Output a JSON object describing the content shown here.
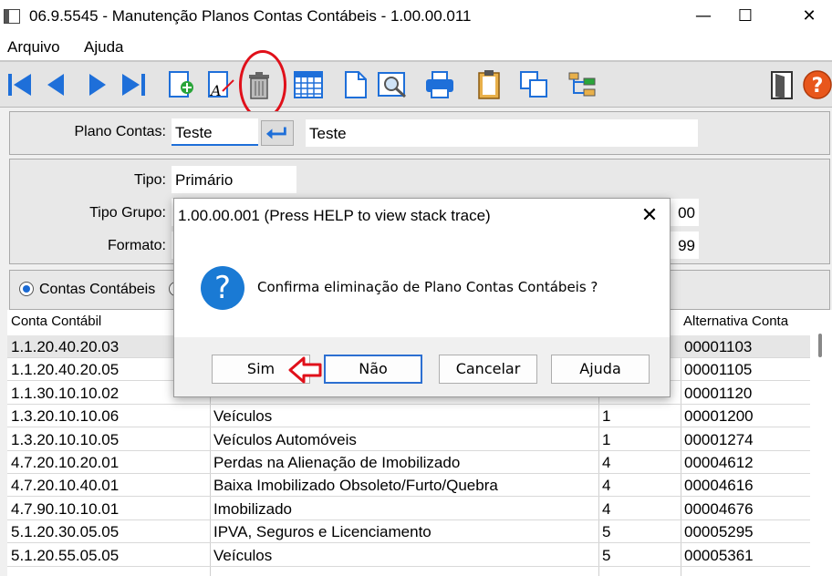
{
  "window": {
    "title": "06.9.5545 - Manutenção Planos Contas Contábeis - 1.00.00.011",
    "minimize": "—",
    "maximize": "☐",
    "close": "✕"
  },
  "menu": [
    "Arquivo",
    "Ajuda"
  ],
  "toolbar": {
    "buttons": [
      "first-icon",
      "previous-icon",
      "next-icon",
      "last-icon",
      "new-record-icon",
      "edit-icon",
      "delete-icon",
      "grid-icon",
      "document-icon",
      "preview-icon",
      "print-icon",
      "clipboard-icon",
      "copy-icon",
      "tree-icon",
      "exit-door-icon",
      "help-icon"
    ],
    "help": "?"
  },
  "form": {
    "plano_contas_label": "Plano Contas:",
    "plano_contas_value": "Teste",
    "plano_contas_desc": "Teste",
    "tipo_label": "Tipo:",
    "tipo_value": "Primário",
    "tipo_grupo_label": "Tipo Grupo:",
    "tipo_grupo_value_tail": "00",
    "formato_label": "Formato:",
    "formato_value_tail": "99"
  },
  "radio": {
    "option1": "Contas Contábeis"
  },
  "grid": {
    "headers": {
      "conta": "Conta Contábil",
      "alternativa": "Alternativa Conta"
    },
    "rows": [
      {
        "conta": "1.1.20.40.20.03",
        "descricao": "",
        "tipo": "",
        "alt": "00001103"
      },
      {
        "conta": "1.1.20.40.20.05",
        "descricao": "",
        "tipo": "",
        "alt": "00001105"
      },
      {
        "conta": "1.1.30.10.10.02",
        "descricao": "",
        "tipo": "",
        "alt": "00001120"
      },
      {
        "conta": "1.3.20.10.10.06",
        "descricao": "Veículos",
        "tipo": "1",
        "alt": "00001200"
      },
      {
        "conta": "1.3.20.10.10.05",
        "descricao": "Veículos Automóveis",
        "tipo": "1",
        "alt": "00001274"
      },
      {
        "conta": "4.7.20.10.20.01",
        "descricao": "Perdas na Alienação de Imobilizado",
        "tipo": "4",
        "alt": "00004612"
      },
      {
        "conta": "4.7.20.10.40.01",
        "descricao": "Baixa Imobilizado Obsoleto/Furto/Quebra",
        "tipo": "4",
        "alt": "00004616"
      },
      {
        "conta": "4.7.90.10.10.01",
        "descricao": "Imobilizado",
        "tipo": "4",
        "alt": "00004676"
      },
      {
        "conta": "5.1.20.30.05.05",
        "descricao": "IPVA, Seguros e Licenciamento",
        "tipo": "5",
        "alt": "00005295"
      },
      {
        "conta": "5.1.20.55.05.05",
        "descricao": "Veículos",
        "tipo": "5",
        "alt": "00005361"
      }
    ]
  },
  "dialog": {
    "title": "1.00.00.001 (Press HELP to view stack trace)",
    "close": "✕",
    "icon": "?",
    "message": "Confirma eliminação de Plano Contas Contábeis ?",
    "buttons": {
      "sim": "Sim",
      "nao": "Não",
      "cancelar": "Cancelar",
      "ajuda": "Ajuda"
    }
  },
  "colors": {
    "annotation": "#e0101a",
    "accent": "#1a7ad4"
  }
}
